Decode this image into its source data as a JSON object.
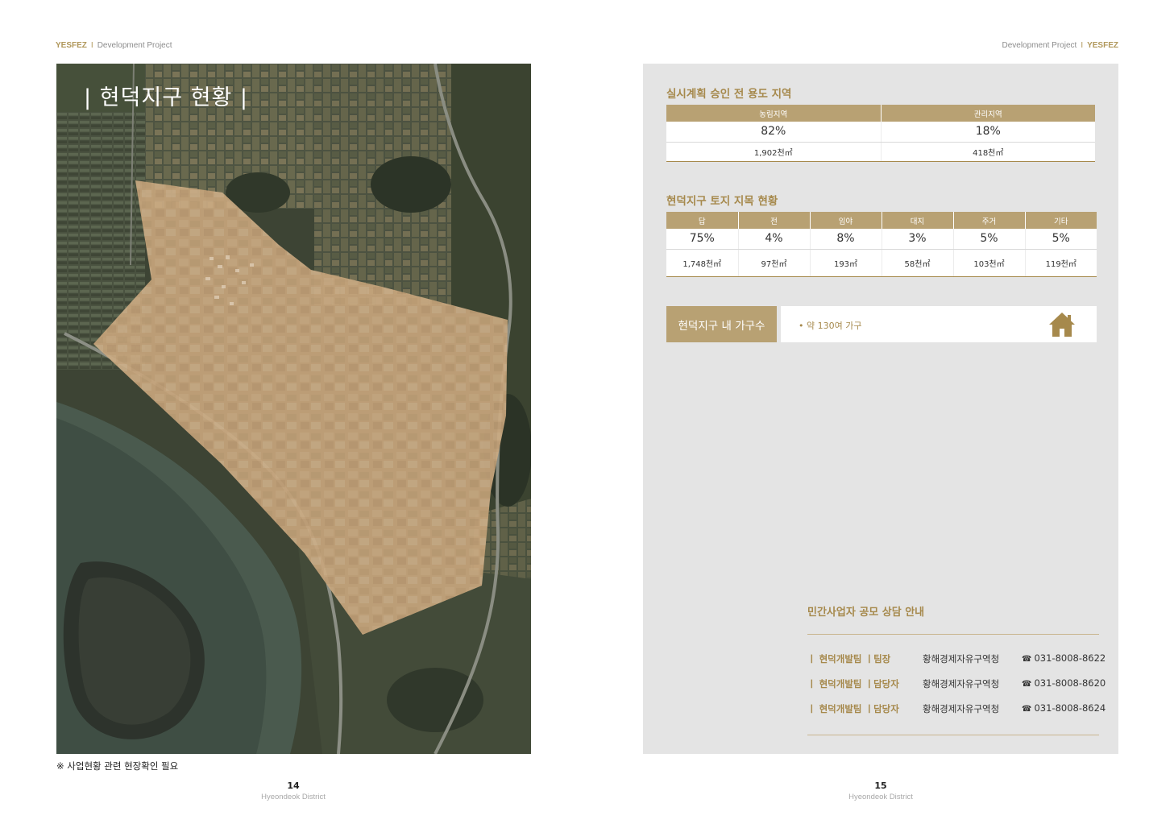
{
  "header": {
    "left": {
      "brand": "YESFEZ",
      "separator": "I",
      "project": "Development Project"
    },
    "right": {
      "project": "Development Project",
      "separator": "I",
      "brand": "YESFEZ"
    }
  },
  "left_page": {
    "title": "| 현덕지구 현황 |",
    "note": "※ 사업현황 관련 현장확인 필요",
    "page_number": "14",
    "district": "Hyeondeok District"
  },
  "right_page": {
    "zoning": {
      "title": "실시계획 승인 전 용도 지역",
      "columns": [
        {
          "label": "농림지역",
          "percent": "82%",
          "area": "1,902천㎡"
        },
        {
          "label": "관리지역",
          "percent": "18%",
          "area": "418천㎡"
        }
      ]
    },
    "land": {
      "title": "현덕지구 토지 지목 현황",
      "columns": [
        {
          "label": "답",
          "percent": "75%",
          "area": "1,748천㎡"
        },
        {
          "label": "전",
          "percent": "4%",
          "area": "97천㎡"
        },
        {
          "label": "임야",
          "percent": "8%",
          "area": "193㎡"
        },
        {
          "label": "대지",
          "percent": "3%",
          "area": "58천㎡"
        },
        {
          "label": "주거",
          "percent": "5%",
          "area": "103천㎡"
        },
        {
          "label": "기타",
          "percent": "5%",
          "area": "119천㎡"
        }
      ]
    },
    "households": {
      "label": "현덕지구 내 가구수",
      "value": "• 약 130여 가구",
      "icon": "home-icon"
    },
    "contact": {
      "title": "민간사업자 공모 상담 안내",
      "rows": [
        {
          "team": "ㅣ 현덕개발팀 ㅣ팀장",
          "org": "황해경제자유구역청",
          "phone_icon": "☎",
          "phone": "031-8008-8622"
        },
        {
          "team": "ㅣ 현덕개발팀 ㅣ담당자",
          "org": "황해경제자유구역청",
          "phone_icon": "☎",
          "phone": "031-8008-8620"
        },
        {
          "team": "ㅣ 현덕개발팀 ㅣ담당자",
          "org": "황해경제자유구역청",
          "phone_icon": "☎",
          "phone": "031-8008-8624"
        }
      ]
    },
    "page_number": "15",
    "district": "Hyeondeok District"
  },
  "colors": {
    "accent": "#a6894c",
    "table_header": "#b8a173",
    "panel_bg": "#e4e4e4",
    "district_overlay": "#c9a47a"
  }
}
